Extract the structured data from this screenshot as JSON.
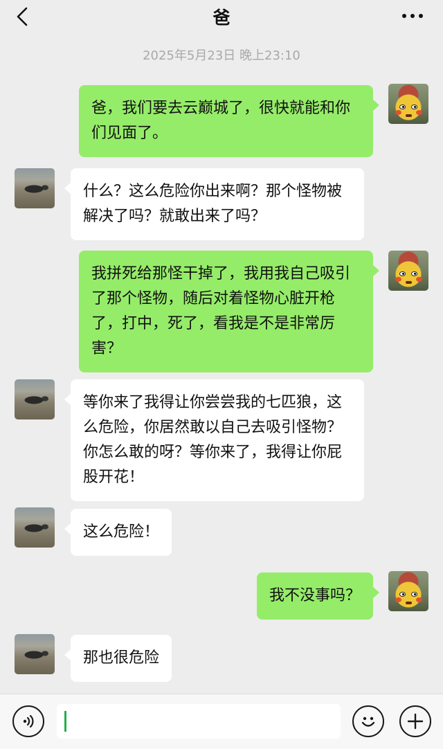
{
  "header": {
    "title": "爸",
    "back_icon": "chevron-left-icon",
    "more_icon": "ellipsis-icon"
  },
  "timestamp": "2025年5月23日 晚上23:10",
  "messages": [
    {
      "from": "me",
      "text": "爸，我们要去云巅城了，很快就能和你们见面了。"
    },
    {
      "from": "dad",
      "text": "什么？这么危险你出来啊？那个怪物被解决了吗？就敢出来了吗？"
    },
    {
      "from": "me",
      "text": "我拼死给那怪干掉了，我用我自己吸引了那个怪物，随后对着怪物心脏开枪了，打中，死了，看我是不是非常厉害？"
    },
    {
      "from": "dad",
      "text": "等你来了我得让你尝尝我的七匹狼，这么危险，你居然敢以自己去吸引怪物？你怎么敢的呀？等你来了，我得让你屁股开花！"
    },
    {
      "from": "dad",
      "text": "这么危险！"
    },
    {
      "from": "me",
      "text": "我不没事吗？"
    },
    {
      "from": "dad",
      "text": "那也很危险"
    }
  ],
  "input_bar": {
    "voice_icon": "voice-icon",
    "text_value": "",
    "emoji_icon": "emoji-icon",
    "plus_icon": "plus-icon"
  },
  "colors": {
    "background": "#ededed",
    "outgoing_bubble": "#95ec69",
    "incoming_bubble": "#ffffff",
    "caret": "#22b04a"
  }
}
